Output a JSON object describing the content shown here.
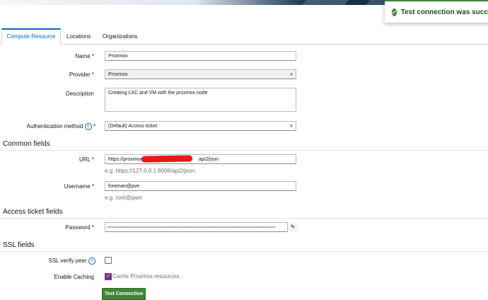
{
  "toast": {
    "message": "Test connection was successful"
  },
  "tabs": [
    {
      "label": "Compute Resource"
    },
    {
      "label": "Locations"
    },
    {
      "label": "Organizations"
    }
  ],
  "form": {
    "name_label": "Name *",
    "name_value": "Proxmox",
    "provider_label": "Provider *",
    "provider_value": "Proxmox",
    "description_label": "Description",
    "description_value": "Creating LXC and VM with the proxmox node",
    "auth_label": "Authentication method",
    "auth_req": "*",
    "auth_value": "(Default) Access ticket"
  },
  "common": {
    "title": "Common fields",
    "url_label": "URL *",
    "url_value_start": "https://proxmox",
    "url_value_end": "api2/json",
    "url_help": "e.g. https://127.0.0.1:8006/api2/json",
    "username_label": "Username *",
    "username_value": "foreman@pve",
    "username_help": "e.g. root@pam"
  },
  "access": {
    "title": "Access ticket fields",
    "password_label": "Password *"
  },
  "ssl": {
    "title": "SSL fields",
    "verify_label": "SSL verify peer",
    "caching_label": "Enable Caching",
    "caching_text": "Cache Proxmox resources."
  },
  "actions": {
    "test_label": "Test Connection"
  },
  "colors": {
    "primary": "#0066cc",
    "success": "#3e8635",
    "checkbox": "#7b2e8e"
  }
}
